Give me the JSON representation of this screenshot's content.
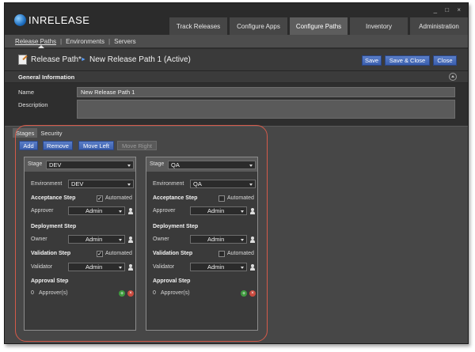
{
  "app": {
    "logo_text": "INRELEASE",
    "window_controls": "_ □ ×"
  },
  "top_tabs": [
    {
      "label": "Track Releases"
    },
    {
      "label": "Configure Apps"
    },
    {
      "label": "Configure Paths",
      "active": true
    },
    {
      "label": "Inventory"
    },
    {
      "label": "Administration"
    }
  ],
  "subnav": {
    "items": [
      "Release Paths",
      "Environments",
      "Servers"
    ],
    "separator": "|"
  },
  "titlebar": {
    "title": "Release Path*",
    "arrow": "►",
    "subtitle": "New Release Path 1 (Active)",
    "buttons": {
      "save": "Save",
      "save_close": "Save & Close",
      "close": "Close"
    }
  },
  "general": {
    "section_title": "General Information",
    "name_label": "Name",
    "name_value": "New Release Path 1",
    "description_label": "Description",
    "description_value": ""
  },
  "stage_tabs": [
    {
      "label": "Stages",
      "active": true
    },
    {
      "label": "Security"
    }
  ],
  "stage_actions": {
    "add": "Add",
    "remove": "Remove",
    "move_left": "Move Left",
    "move_right": "Move Right"
  },
  "labels": {
    "stage": "Stage",
    "environment": "Environment",
    "acceptance": "Acceptance Step",
    "approver": "Approver",
    "deployment": "Deployment Step",
    "owner": "Owner",
    "validation": "Validation Step",
    "validator": "Validator",
    "approval": "Approval Step",
    "approvers_suffix": "Approver(s)",
    "automated": "Automated",
    "check_mark": "✓",
    "plus": "+",
    "times": "×"
  },
  "stages": [
    {
      "stage": "DEV",
      "environment": "DEV",
      "approver": "Admin",
      "acceptance_automated": true,
      "owner": "Admin",
      "validator": "Admin",
      "validation_automated": true,
      "approvers_count": "0"
    },
    {
      "stage": "QA",
      "environment": "QA",
      "approver": "Admin",
      "acceptance_automated": false,
      "owner": "Admin",
      "validator": "Admin",
      "validation_automated": false,
      "approvers_count": "0"
    }
  ],
  "colors": {
    "accent_blue": "#3b5fae",
    "highlight_red": "#d45a4a",
    "add_green": "#3f9a3f",
    "remove_red": "#c94a3f"
  }
}
